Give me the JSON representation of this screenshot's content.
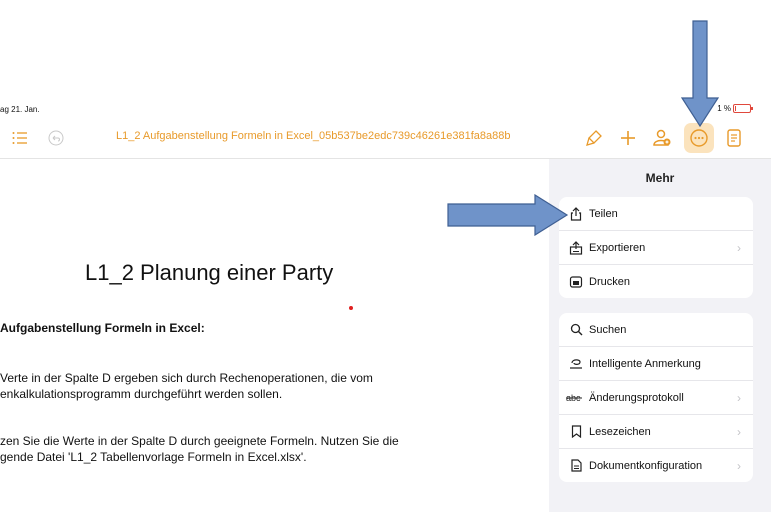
{
  "status": {
    "date": "ag 21. Jan.",
    "battery": "1 %",
    "battery_level": 0.05
  },
  "toolbar": {
    "title": "L1_2 Aufgabenstellung Formeln in Excel_05b537be2edc739c46261e381fa8a88b",
    "icons": [
      "list-icon",
      "undo-icon",
      "paintbrush-icon",
      "plus-icon",
      "collaborate-icon",
      "more-icon",
      "document-icon"
    ]
  },
  "document": {
    "heading": "L1_2 Planung einer Party",
    "subheading": "Aufgabenstellung Formeln in Excel:",
    "para1_line1": "Verte in der Spalte D ergeben sich durch Rechenoperationen, die vom",
    "para1_line2": "enkalkulationsprogramm durchgeführt werden sollen.",
    "para2_line1": "zen Sie die Werte in der Spalte D durch geeignete Formeln. Nutzen Sie die",
    "para2_line2": "gende Datei 'L1_2 Tabellenvorlage Formeln in Excel.xlsx'."
  },
  "menu": {
    "title": "Mehr",
    "group1": [
      {
        "label": "Teilen",
        "icon": "share-icon",
        "chevron": false
      },
      {
        "label": "Exportieren",
        "icon": "export-icon",
        "chevron": true
      },
      {
        "label": "Drucken",
        "icon": "print-icon",
        "chevron": false
      }
    ],
    "group2": [
      {
        "label": "Suchen",
        "icon": "search-icon",
        "chevron": false
      },
      {
        "label": "Intelligente Anmerkung",
        "icon": "smart-annotation-icon",
        "chevron": false
      },
      {
        "label": "Änderungsprotokoll",
        "icon": "track-changes-icon",
        "chevron": true
      },
      {
        "label": "Lesezeichen",
        "icon": "bookmark-icon",
        "chevron": true
      },
      {
        "label": "Dokumentkonfiguration",
        "icon": "document-setup-icon",
        "chevron": true
      }
    ]
  },
  "colors": {
    "accent": "#e89a2a",
    "arrow": "#6f93c9",
    "arrow_border": "#3f5f92",
    "panel_bg": "#f2f2f6"
  }
}
